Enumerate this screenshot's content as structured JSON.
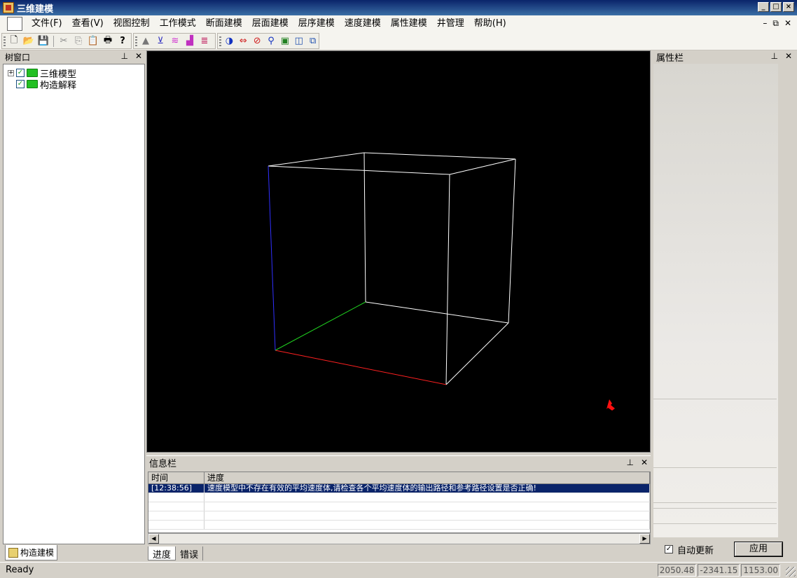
{
  "window": {
    "title": "三维建模"
  },
  "menu": [
    "文件(F)",
    "查看(V)",
    "视图控制",
    "工作模式",
    "断面建模",
    "层面建模",
    "层序建模",
    "速度建模",
    "属性建模",
    "井管理",
    "帮助(H)"
  ],
  "tree_pane": {
    "title": "树窗口",
    "items": [
      {
        "label": "三维模型",
        "expanded": false,
        "checked": true
      },
      {
        "label": "构造解释",
        "checked": true
      }
    ],
    "tab_label": "构造建模"
  },
  "viewport": {
    "background": "#000000"
  },
  "info_pane": {
    "title": "信息栏",
    "columns": [
      "时间",
      "进度"
    ],
    "rows": [
      {
        "time": "[12:38:56]",
        "message": "速度模型中不存在有效的平均速度体,请检查各个平均速度体的输出路径和参考路径设置是否正确!"
      }
    ],
    "tabs": [
      "进度",
      "错误"
    ]
  },
  "property_pane": {
    "title": "属性栏",
    "auto_update_label": "自动更新",
    "auto_update_checked": true,
    "apply_label": "应用"
  },
  "status": {
    "text": "Ready",
    "coords": [
      "2050.48",
      "-2341.15",
      "1153.00"
    ]
  },
  "colors": {
    "accent": "#0a246a",
    "axis_x": "#ff2020",
    "axis_y": "#20d020",
    "axis_z": "#3030ff"
  }
}
